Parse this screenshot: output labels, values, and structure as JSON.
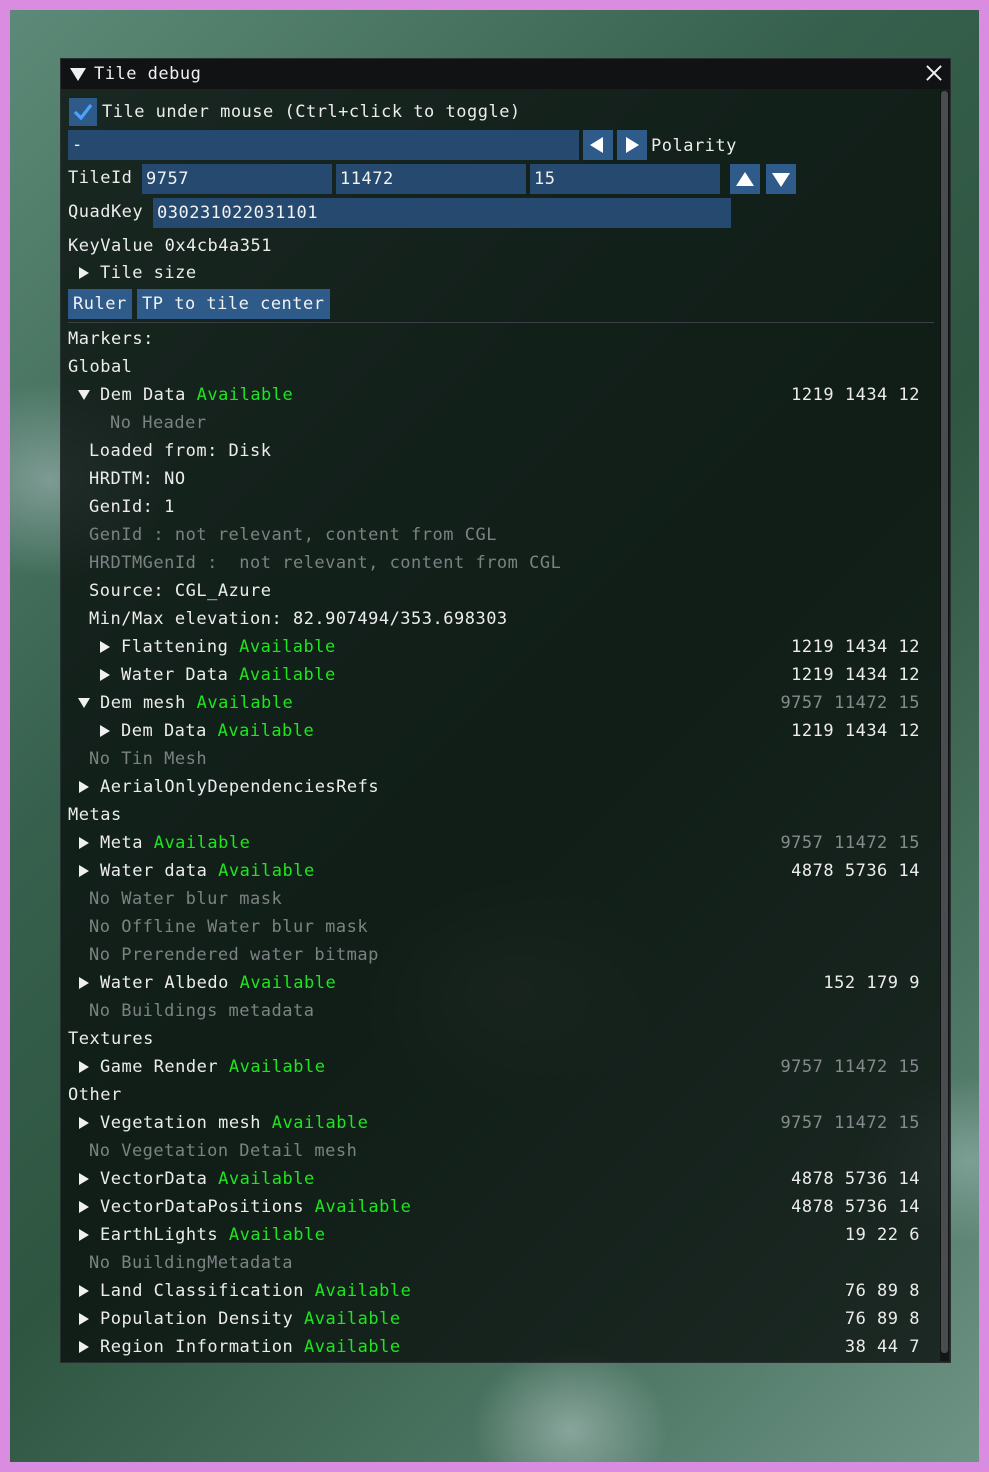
{
  "window": {
    "title": "Tile debug"
  },
  "top": {
    "checkbox_label": "Tile under mouse (Ctrl+click to toggle)",
    "checked": true,
    "polarity_value": "-",
    "polarity_label": "Polarity",
    "tileid_label": "TileId",
    "tileid_x": "9757",
    "tileid_y": "11472",
    "tileid_z": "15",
    "quadkey_label": "QuadKey",
    "quadkey_value": "030231022031101",
    "keyvalue_text": "KeyValue 0x4cb4a351",
    "tile_size_label": "Tile size",
    "ruler_button": "Ruler",
    "tp_button": "TP to tile center"
  },
  "markers": {
    "header": "Markers:",
    "global": {
      "label": "Global",
      "dem_data": {
        "name": "Dem Data",
        "status": "Available",
        "coords": "1219 1434 12"
      },
      "no_header": "No Header",
      "loaded_from": "Loaded from: Disk",
      "hrdtm": "HRDTM: NO",
      "genid": "GenId: 1",
      "genid_note": "GenId : not relevant, content from CGL",
      "hrdtm_genid_note": "HRDTMGenId :  not relevant, content from CGL",
      "source": "Source: CGL_Azure",
      "minmax": "Min/Max elevation: 82.907494/353.698303",
      "flattening": {
        "name": "Flattening",
        "status": "Available",
        "coords": "1219 1434 12"
      },
      "water_data": {
        "name": "Water Data",
        "status": "Available",
        "coords": "1219 1434 12"
      },
      "dem_mesh": {
        "name": "Dem mesh",
        "status": "Available",
        "coords": "9757 11472 15"
      },
      "dem_mesh_dem_data": {
        "name": "Dem Data",
        "status": "Available",
        "coords": "1219 1434 12"
      },
      "no_tin_mesh": "No Tin Mesh",
      "aerial_only": "AerialOnlyDependenciesRefs"
    },
    "metas": {
      "label": "Metas",
      "meta": {
        "name": "Meta",
        "status": "Available",
        "coords": "9757 11472 15"
      },
      "water_data": {
        "name": "Water data",
        "status": "Available",
        "coords": "4878 5736 14"
      },
      "no_water_blur": "No Water blur mask",
      "no_offline_water_blur": "No Offline Water blur mask",
      "no_prerendered_water": "No Prerendered water bitmap",
      "water_albedo": {
        "name": "Water Albedo",
        "status": "Available",
        "coords": "152 179 9"
      },
      "no_buildings_metadata": "No Buildings metadata"
    },
    "textures": {
      "label": "Textures",
      "game_render": {
        "name": "Game Render",
        "status": "Available",
        "coords": "9757 11472 15"
      }
    },
    "other": {
      "label": "Other",
      "vegetation_mesh": {
        "name": "Vegetation mesh",
        "status": "Available",
        "coords": "9757 11472 15"
      },
      "no_vegetation_detail": "No Vegetation Detail mesh",
      "vector_data": {
        "name": "VectorData",
        "status": "Available",
        "coords": "4878 5736 14"
      },
      "vector_data_positions": {
        "name": "VectorDataPositions",
        "status": "Available",
        "coords": "4878 5736 14"
      },
      "earth_lights": {
        "name": "EarthLights",
        "status": "Available",
        "coords": "19 22 6"
      },
      "no_building_metadata": "No BuildingMetadata",
      "land_classification": {
        "name": "Land Classification",
        "status": "Available",
        "coords": "76 89 8"
      },
      "population_density": {
        "name": "Population Density",
        "status": "Available",
        "coords": "76 89 8"
      },
      "region_information": {
        "name": "Region Information",
        "status": "Available",
        "coords": "38 44 7"
      }
    }
  },
  "colors": {
    "available": "#1ee61e",
    "disabled_text": "#7c8283",
    "button": "#2e5b8a",
    "input": "#264a6f"
  }
}
